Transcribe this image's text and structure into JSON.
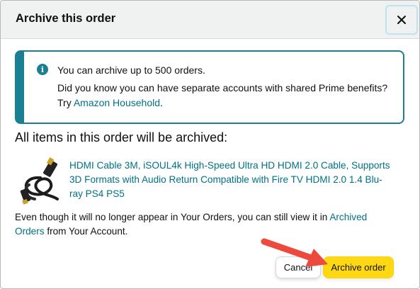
{
  "dialog": {
    "title": "Archive this order",
    "close_icon": "close-icon"
  },
  "info": {
    "icon": "info-icon",
    "icon_glyph": "i",
    "line1": "You can archive up to 500 orders.",
    "line2": "Did you know you can have separate accounts with shared Prime benefits?",
    "line3_prefix": "Try ",
    "line3_link": "Amazon Household",
    "line3_suffix": ".",
    "accent_color": "#1a7f92"
  },
  "section_heading": "All items in this order will be archived:",
  "product": {
    "title_line1": "HDMI Cable 3M, iSOUL4k High-Speed Ultra HD HDMI 2.0 Cable, Supports",
    "title_line2": "3D Formats with Audio Return Compatible with Fire TV HDMI 2.0 1.4 Blu-",
    "title_line3": "ray PS4 PS5"
  },
  "note": {
    "text_before": "Even though it will no longer appear in Your Orders, you can still view it in ",
    "link_part1": "Archived",
    "link_part2": "Orders",
    "text_after": " from Your Account."
  },
  "buttons": {
    "cancel": "Cancel",
    "archive": "Archive order",
    "archive_color": "#ffd814"
  },
  "annotation": {
    "arrow_color": "#ec4a3c"
  }
}
